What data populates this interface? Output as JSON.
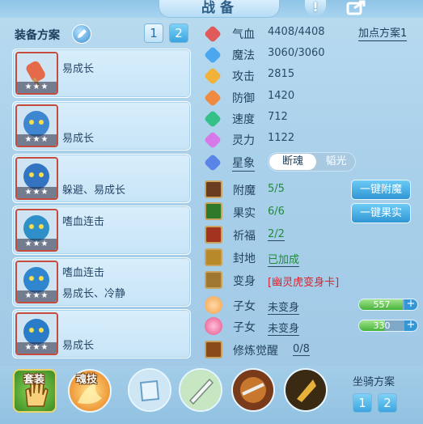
{
  "header": {
    "title": "战备"
  },
  "left": {
    "plan_label": "装备方案",
    "plan_buttons": [
      "1",
      "2"
    ],
    "slots": [
      {
        "lines": [
          "易成长"
        ],
        "stars": "★★★"
      },
      {
        "lines": [
          "易成长"
        ],
        "stars": "★★★"
      },
      {
        "lines": [
          "躲避、易成长"
        ],
        "stars": "★★★"
      },
      {
        "lines": [
          "嗜血连击"
        ],
        "stars": "★★★"
      },
      {
        "lines": [
          "嗜血连击",
          "易成长、冷静"
        ],
        "stars": "★★★"
      },
      {
        "lines": [
          "易成长"
        ],
        "stars": "★★★"
      }
    ]
  },
  "attributes": {
    "add_plan": "加点方案1",
    "items": [
      {
        "label": "气血",
        "value": "4408/4408",
        "icon": "heart-icon",
        "color": "#e05a5a"
      },
      {
        "label": "魔法",
        "value": "3060/3060",
        "icon": "mana-icon",
        "color": "#4aa7f0"
      },
      {
        "label": "攻击",
        "value": "2815",
        "icon": "attack-icon",
        "color": "#f2b23a"
      },
      {
        "label": "防御",
        "value": "1420",
        "icon": "defense-icon",
        "color": "#f08a40"
      },
      {
        "label": "速度",
        "value": "712",
        "icon": "speed-icon",
        "color": "#35c08a"
      },
      {
        "label": "灵力",
        "value": "1122",
        "icon": "spirit-icon",
        "color": "#d779e8"
      }
    ],
    "xingxiang": {
      "label": "星象",
      "option_on": "断魂",
      "option_off": "韬光"
    }
  },
  "enhance": {
    "fumo": {
      "label": "附魔",
      "value": "5/5"
    },
    "guoshi": {
      "label": "果实",
      "value": "6/6"
    },
    "qifu": {
      "label": "祈福",
      "value": "2/2"
    },
    "fengdi": {
      "label": "封地",
      "value": "已加成"
    },
    "bianshen": {
      "label": "变身",
      "value": "[幽灵虎变身卡]"
    },
    "btn_fumo": "一键附魔",
    "btn_guoshi": "一键果实"
  },
  "children": [
    {
      "label": "子女",
      "value": "未变身",
      "bar_value": "557",
      "bar_fill": 0.75
    },
    {
      "label": "子女",
      "value": "未变身",
      "bar_value": "330",
      "bar_fill": 0.45
    }
  ],
  "xiulian": {
    "label": "修炼觉醒",
    "value": "0/8"
  },
  "bottom": {
    "taozhuang": "套装",
    "hunji": "魂技",
    "mount_label": "坐骑方案",
    "mount_buttons": [
      "1",
      "2"
    ]
  },
  "colors": {
    "accent": "#3aa4e0",
    "green_value": "#1f8c3a",
    "red_value": "#d9232e"
  }
}
